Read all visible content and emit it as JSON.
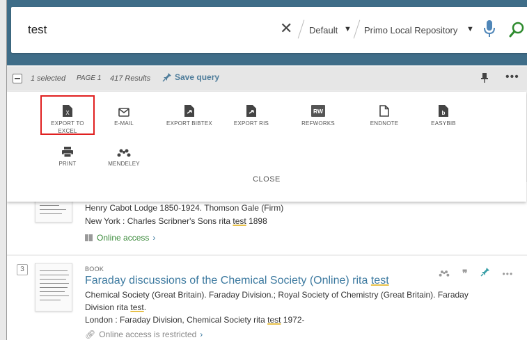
{
  "search": {
    "query": "test",
    "scope_1": "Default",
    "scope_2": "Primo Local Repository",
    "icons": [
      "close-icon",
      "chevron-down-icon",
      "microphone-icon",
      "search-icon"
    ]
  },
  "toolbar": {
    "selected": "1 selected",
    "page": "PAGE 1",
    "results": "417 Results",
    "save_query": "Save query",
    "more": "•••"
  },
  "export_panel": {
    "items": [
      {
        "label_1": "EXPORT TO",
        "label_2": "EXCEL",
        "icon": "excel-file-icon"
      },
      {
        "label_1": "E-MAIL",
        "label_2": "",
        "icon": "envelope-icon"
      },
      {
        "label_1": "EXPORT BIBTEX",
        "label_2": "",
        "icon": "file-arrow-icon"
      },
      {
        "label_1": "EXPORT RIS",
        "label_2": "",
        "icon": "file-arrow-icon"
      },
      {
        "label_1": "REFWORKS",
        "label_2": "",
        "icon": "refworks-icon"
      },
      {
        "label_1": "ENDNOTE",
        "label_2": "",
        "icon": "document-icon"
      },
      {
        "label_1": "EASYBIB",
        "label_2": "",
        "icon": "easybib-icon"
      },
      {
        "label_1": "PRINT",
        "label_2": "",
        "icon": "printer-icon"
      },
      {
        "label_1": "MENDELEY",
        "label_2": "",
        "icon": "mendeley-icon"
      }
    ],
    "close": "CLOSE"
  },
  "results": [
    {
      "authors": "Henry Cabot Lodge 1850-1924. Thomson Gale (Firm)",
      "pub_pre": "New York : Charles Scribner's Sons rita ",
      "pub_hl": "test",
      "pub_post": " 1898",
      "availability": "Online access",
      "availability_color": "#3a8a3a"
    },
    {
      "index": "3",
      "type": "BOOK",
      "title_pre": "Faraday discussions of the Chemical Society (Online) rita ",
      "title_hl": "test",
      "authors_1": "Chemical Society (Great Britain). Faraday Division.; Royal Society of Chemistry (Great Britain). Faraday",
      "authors_2_pre": "Division rita ",
      "authors_2_hl": "test",
      "authors_2_post": ".",
      "pub_pre": "London : Faraday Division, Chemical Society rita ",
      "pub_hl": "test",
      "pub_post": " 1972-",
      "availability": "Online access is restricted",
      "availability_color": "#888888"
    }
  ],
  "colors": {
    "header": "#3f6d88",
    "accent": "#3d7aa0",
    "search_green": "#2e8b2e",
    "highlight_box": "#e02020"
  }
}
